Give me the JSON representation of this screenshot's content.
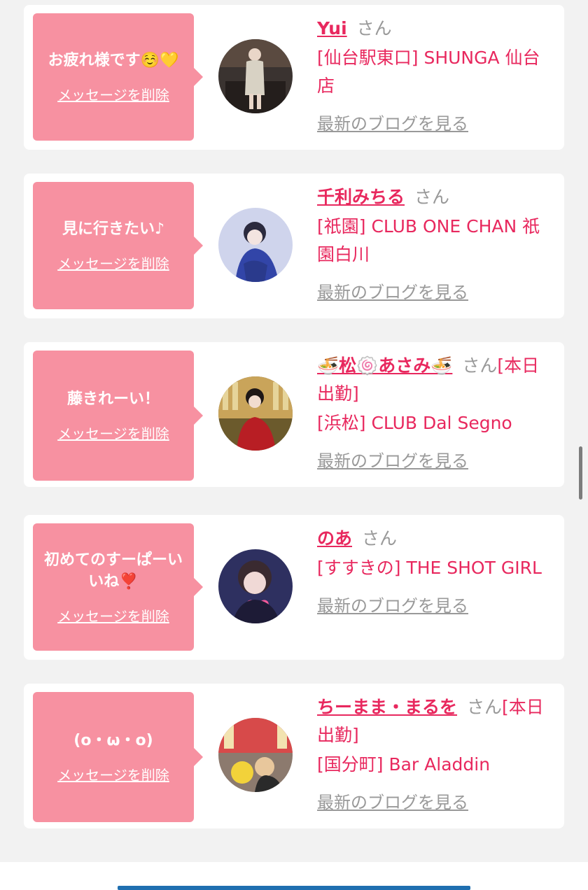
{
  "items": [
    {
      "message": "お疲れ様です☺️💛",
      "delete_label": "メッセージを削除",
      "name": "Yui",
      "honorific": "さん",
      "extra": "",
      "shop": "[仙台駅東口] SHUNGA 仙台店",
      "blog_label": "最新のブログを見る"
    },
    {
      "message": "見に行きたい♪",
      "delete_label": "メッセージを削除",
      "name": "千利みちる",
      "honorific": "さん",
      "extra": "",
      "shop": "[祇園] CLUB ONE CHAN 祇園白川",
      "blog_label": "最新のブログを見る"
    },
    {
      "message": "藤きれーい！",
      "delete_label": "メッセージを削除",
      "name": "🍜松🍥あさみ🍜",
      "honorific": "さん",
      "extra": "[本日出勤]",
      "shop": "[浜松] CLUB Dal Segno",
      "blog_label": "最新のブログを見る"
    },
    {
      "message": "初めてのすーぱーいいね❣️",
      "delete_label": "メッセージを削除",
      "name": "のあ",
      "honorific": "さん",
      "extra": "",
      "shop": "[すすきの] THE SHOT GIRL",
      "blog_label": "最新のブログを見る"
    },
    {
      "message": "(o・ω・o)",
      "delete_label": "メッセージを削除",
      "name": "ちーまま・まるを",
      "honorific": "さん",
      "extra": "[本日出勤]",
      "shop": "[国分町] Bar Aladdin",
      "blog_label": "最新のブログを見る"
    }
  ],
  "colors": {
    "accent": "#e8285e",
    "bubble": "#f791a1",
    "muted": "#999999",
    "background": "#f2f2f2"
  }
}
